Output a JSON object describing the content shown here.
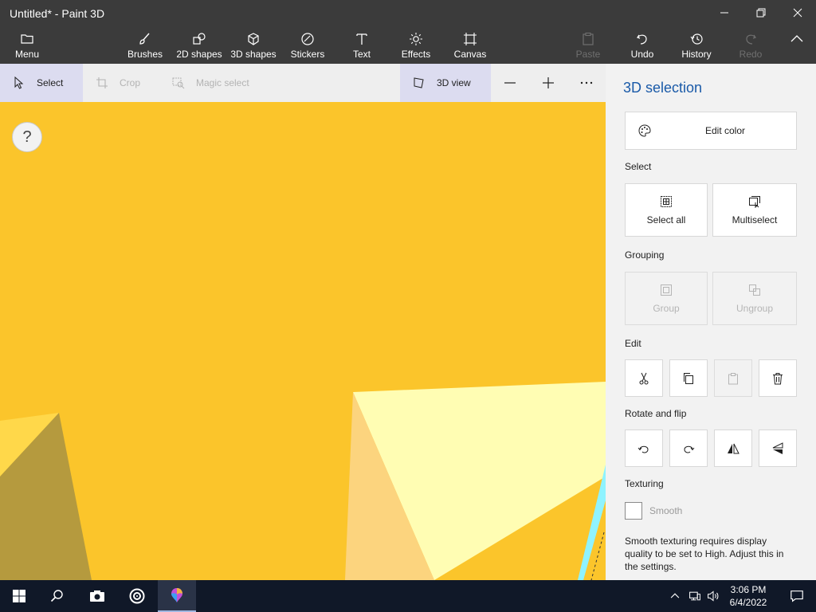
{
  "window": {
    "title": "Untitled* - Paint 3D"
  },
  "ribbon": {
    "menu": "Menu",
    "brushes": "Brushes",
    "shapes_2d": "2D shapes",
    "shapes_3d": "3D shapes",
    "stickers": "Stickers",
    "text": "Text",
    "effects": "Effects",
    "canvas": "Canvas",
    "paste": "Paste",
    "undo": "Undo",
    "history": "History",
    "redo": "Redo"
  },
  "subbar": {
    "select": "Select",
    "crop": "Crop",
    "magic_select": "Magic select",
    "view_3d": "3D view"
  },
  "canvas": {
    "help": "?"
  },
  "panel": {
    "title": "3D selection",
    "edit_color": "Edit color",
    "select_label": "Select",
    "select_all": "Select all",
    "multiselect": "Multiselect",
    "grouping_label": "Grouping",
    "group": "Group",
    "ungroup": "Ungroup",
    "edit_label": "Edit",
    "rotate_label": "Rotate and flip",
    "texturing_label": "Texturing",
    "smooth": "Smooth",
    "smooth_checked": false,
    "texture_note": "Smooth texturing requires display quality to be set to High. Adjust this in the settings."
  },
  "taskbar": {
    "time": "3:06 PM",
    "date": "6/4/2022"
  },
  "colors": {
    "chrome": "#3b3b3b",
    "canvas_yellow": "#fbc52b",
    "accent_blue": "#1a5aa8",
    "taskbar": "#101828"
  }
}
